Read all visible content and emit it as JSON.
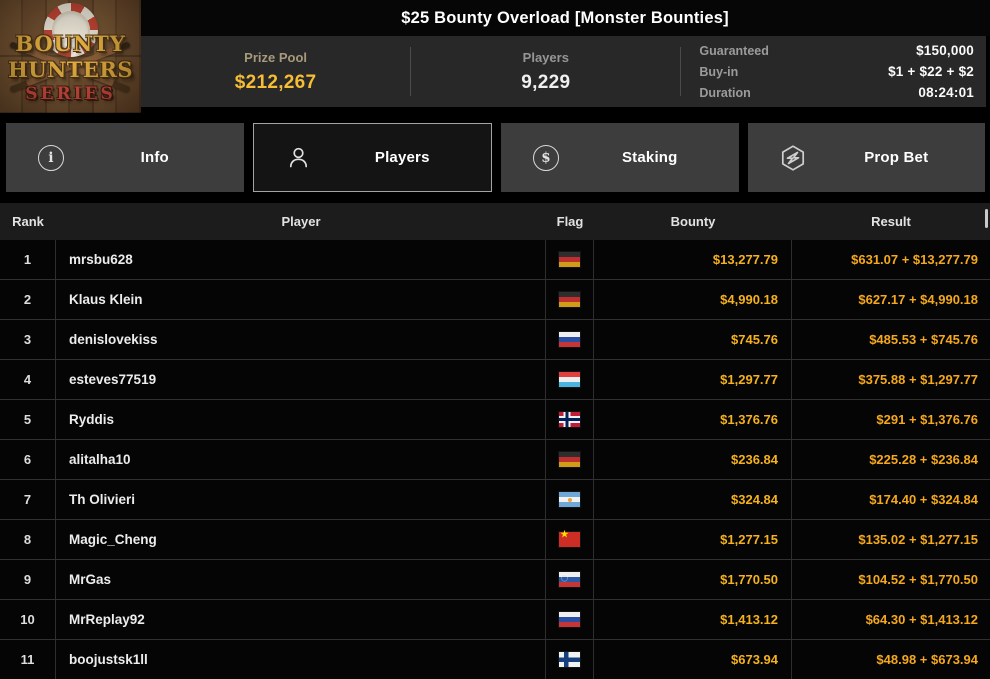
{
  "window": {
    "title": "$25 Bounty Overload [Monster Bounties]"
  },
  "logo": {
    "line1": "BOUNTY",
    "line2": "HUNTERS",
    "line3": "SERIES"
  },
  "stats": {
    "prize_pool": {
      "label": "Prize Pool",
      "value": "$212,267"
    },
    "players": {
      "label": "Players",
      "value": "9,229"
    },
    "details": [
      {
        "label": "Guaranteed",
        "value": "$150,000"
      },
      {
        "label": "Buy-in",
        "value": "$1 + $22 + $2"
      },
      {
        "label": "Duration",
        "value": "08:24:01"
      }
    ]
  },
  "tabs": [
    {
      "label": "Info",
      "icon": "info-icon",
      "active": false
    },
    {
      "label": "Players",
      "icon": "person-icon",
      "active": true
    },
    {
      "label": "Staking",
      "icon": "dollar-circle-icon",
      "active": false
    },
    {
      "label": "Prop Bet",
      "icon": "hexagon-bolt-icon",
      "active": false
    }
  ],
  "table": {
    "columns": [
      "Rank",
      "Player",
      "Flag",
      "Bounty",
      "Result"
    ],
    "rows": [
      {
        "rank": "1",
        "player": "mrsbu628",
        "flag": "germany",
        "bounty": "$13,277.79",
        "result": "$631.07 + $13,277.79"
      },
      {
        "rank": "2",
        "player": "Klaus Klein",
        "flag": "germany",
        "bounty": "$4,990.18",
        "result": "$627.17 + $4,990.18"
      },
      {
        "rank": "3",
        "player": "denislovekiss",
        "flag": "russia",
        "bounty": "$745.76",
        "result": "$485.53 + $745.76"
      },
      {
        "rank": "4",
        "player": "esteves77519",
        "flag": "luxembourg",
        "bounty": "$1,297.77",
        "result": "$375.88 + $1,297.77"
      },
      {
        "rank": "5",
        "player": "Ryddis",
        "flag": "norway",
        "bounty": "$1,376.76",
        "result": "$291 + $1,376.76"
      },
      {
        "rank": "6",
        "player": "alitalha10",
        "flag": "germany",
        "bounty": "$236.84",
        "result": "$225.28 + $236.84"
      },
      {
        "rank": "7",
        "player": "Th Olivieri",
        "flag": "argentina",
        "bounty": "$324.84",
        "result": "$174.40 + $324.84"
      },
      {
        "rank": "8",
        "player": "Magic_Cheng",
        "flag": "china",
        "bounty": "$1,277.15",
        "result": "$135.02 + $1,277.15"
      },
      {
        "rank": "9",
        "player": "MrGas",
        "flag": "slovenia",
        "bounty": "$1,770.50",
        "result": "$104.52 + $1,770.50"
      },
      {
        "rank": "10",
        "player": "MrReplay92",
        "flag": "russia",
        "bounty": "$1,413.12",
        "result": "$64.30 + $1,413.12"
      },
      {
        "rank": "11",
        "player": "boojustsk1ll",
        "flag": "finland",
        "bounty": "$673.94",
        "result": "$48.98 + $673.94"
      }
    ]
  },
  "colors": {
    "money_gold": "#F5B11E",
    "prize_gold": "#F6BD35",
    "tab_inactive_bg": "#3D3D3D",
    "tab_active_border": "#A3A3A3",
    "stats_bg": "#282828",
    "header_bg": "#1C1C1C",
    "row_bg": "#050505"
  }
}
